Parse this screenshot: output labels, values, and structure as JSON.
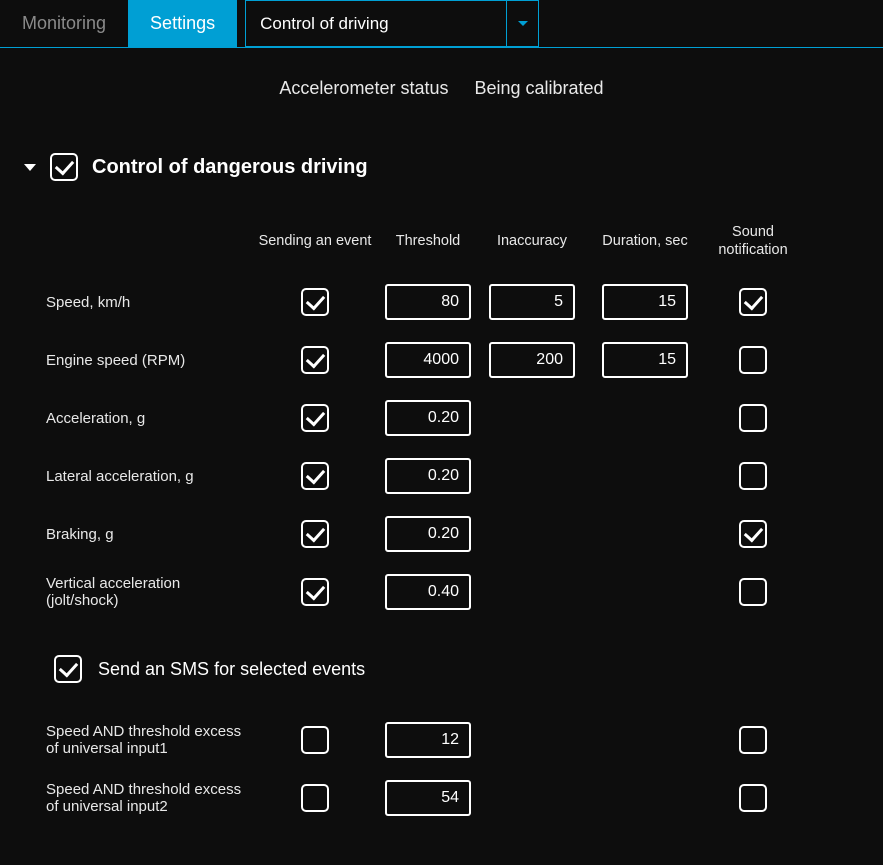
{
  "tabs": {
    "monitoring": "Monitoring",
    "settings": "Settings",
    "dropdown": "Control of driving"
  },
  "status": {
    "label": "Accelerometer status",
    "value": "Being calibrated"
  },
  "section": {
    "title": "Control of dangerous driving",
    "enabled": true,
    "headers": {
      "label": "",
      "send": "Sending an event",
      "threshold": "Threshold",
      "inaccuracy": "Inaccuracy",
      "duration": "Duration, sec",
      "sound": "Sound notification"
    },
    "rows": [
      {
        "label": "Speed, km/h",
        "send": true,
        "threshold": "80",
        "inaccuracy": "5",
        "duration": "15",
        "sound": true
      },
      {
        "label": "Engine speed (RPM)",
        "send": true,
        "threshold": "4000",
        "inaccuracy": "200",
        "duration": "15",
        "sound": false
      },
      {
        "label": "Acceleration, g",
        "send": true,
        "threshold": "0.20",
        "inaccuracy": null,
        "duration": null,
        "sound": false
      },
      {
        "label": "Lateral acceleration, g",
        "send": true,
        "threshold": "0.20",
        "inaccuracy": null,
        "duration": null,
        "sound": false
      },
      {
        "label": "Braking, g",
        "send": true,
        "threshold": "0.20",
        "inaccuracy": null,
        "duration": null,
        "sound": true
      },
      {
        "label": "Vertical acceleration (jolt/shock)",
        "send": true,
        "threshold": "0.40",
        "inaccuracy": null,
        "duration": null,
        "sound": false
      }
    ]
  },
  "sms": {
    "title": "Send an SMS for selected events",
    "enabled": true
  },
  "extra_rows": [
    {
      "label": "Speed AND threshold excess of universal input1",
      "send": false,
      "value": "12",
      "sound": false
    },
    {
      "label": "Speed AND threshold excess of universal input2",
      "send": false,
      "value": "54",
      "sound": false
    }
  ]
}
